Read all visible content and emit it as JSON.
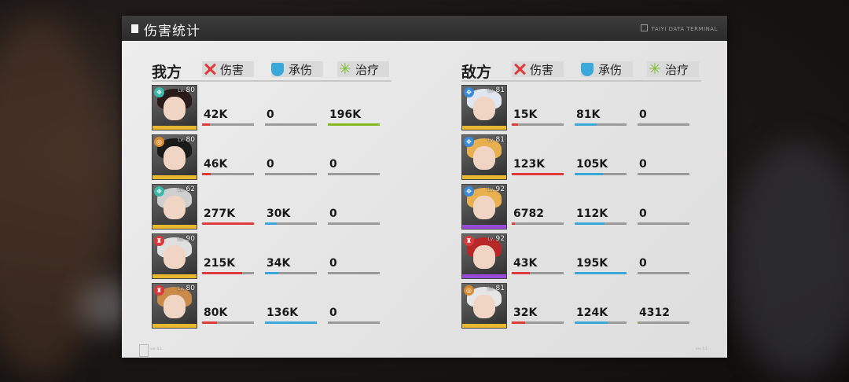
{
  "panel": {
    "title": "伤害统计",
    "terminal_label": "TAIYI DATA TERMINAL",
    "version_left": "ver. 0.1",
    "version_right": "ver. 0.1"
  },
  "headers": {
    "damage": "伤害",
    "taken": "承伤",
    "heal": "治疗"
  },
  "colors": {
    "damage": "#e03a3a",
    "taken": "#3aa8d8",
    "heal": "#86b81f",
    "track": "#9a9a9a"
  },
  "allies": {
    "title": "我方",
    "rows": [
      {
        "level": "80",
        "lv_prefix": "Lv.",
        "class_icon": "support-icon",
        "class_color": "#3cb8a8",
        "hair": "#2a1a1a",
        "strip": "#e8b830",
        "damage": "42K",
        "damage_ratio": 0.15,
        "taken": "0",
        "taken_ratio": 0,
        "heal": "196K",
        "heal_ratio": 1.0
      },
      {
        "level": "80",
        "lv_prefix": "Lv.",
        "class_icon": "attack-icon",
        "class_color": "#d88a30",
        "hair": "#1a1a1a",
        "strip": "#e8b830",
        "damage": "46K",
        "damage_ratio": 0.17,
        "taken": "0",
        "taken_ratio": 0,
        "heal": "0",
        "heal_ratio": 0
      },
      {
        "level": "62",
        "lv_prefix": "Lv.",
        "class_icon": "support-icon",
        "class_color": "#3cb8a8",
        "hair": "#cfcfcf",
        "strip": "#e8b830",
        "damage": "277K",
        "damage_ratio": 1.0,
        "taken": "30K",
        "taken_ratio": 0.22,
        "heal": "0",
        "heal_ratio": 0
      },
      {
        "level": "90",
        "lv_prefix": "Lv.",
        "class_icon": "tower-icon",
        "class_color": "#d83a3a",
        "hair": "#e0e0e0",
        "strip": "#e8b830",
        "damage": "215K",
        "damage_ratio": 0.78,
        "taken": "34K",
        "taken_ratio": 0.25,
        "heal": "0",
        "heal_ratio": 0
      },
      {
        "level": "80",
        "lv_prefix": "Lv.",
        "class_icon": "tower-icon",
        "class_color": "#d83a3a",
        "hair": "#c98a4a",
        "strip": "#e8b830",
        "damage": "80K",
        "damage_ratio": 0.29,
        "taken": "136K",
        "taken_ratio": 1.0,
        "heal": "0",
        "heal_ratio": 0
      }
    ]
  },
  "enemies": {
    "title": "敌方",
    "rows": [
      {
        "level": "81",
        "lv_prefix": "Lv.",
        "class_icon": "support-icon",
        "class_color": "#3a8ad8",
        "hair": "#dfe6f0",
        "strip": "#e8b830",
        "damage": "15K",
        "damage_ratio": 0.12,
        "taken": "81K",
        "taken_ratio": 0.42,
        "heal": "0",
        "heal_ratio": 0
      },
      {
        "level": "81",
        "lv_prefix": "Lv.",
        "class_icon": "support-icon",
        "class_color": "#3a8ad8",
        "hair": "#e8b050",
        "strip": "#e8b830",
        "damage": "123K",
        "damage_ratio": 1.0,
        "taken": "105K",
        "taken_ratio": 0.54,
        "heal": "0",
        "heal_ratio": 0
      },
      {
        "level": "92",
        "lv_prefix": "Lv.",
        "class_icon": "support-icon",
        "class_color": "#3a8ad8",
        "hair": "#e8b050",
        "strip": "#9a4ad8",
        "damage": "6782",
        "damage_ratio": 0.06,
        "taken": "112K",
        "taken_ratio": 0.57,
        "heal": "0",
        "heal_ratio": 0
      },
      {
        "level": "92",
        "lv_prefix": "Lv.",
        "class_icon": "tower-icon",
        "class_color": "#d83a3a",
        "hair": "#b82828",
        "strip": "#9a4ad8",
        "damage": "43K",
        "damage_ratio": 0.35,
        "taken": "195K",
        "taken_ratio": 1.0,
        "heal": "0",
        "heal_ratio": 0
      },
      {
        "level": "81",
        "lv_prefix": "Lv.",
        "class_icon": "attack-icon",
        "class_color": "#d88a30",
        "hair": "#e6e6e6",
        "strip": "#e8b830",
        "damage": "32K",
        "damage_ratio": 0.26,
        "taken": "124K",
        "taken_ratio": 0.64,
        "heal": "4312",
        "heal_ratio": 0.02
      }
    ]
  }
}
